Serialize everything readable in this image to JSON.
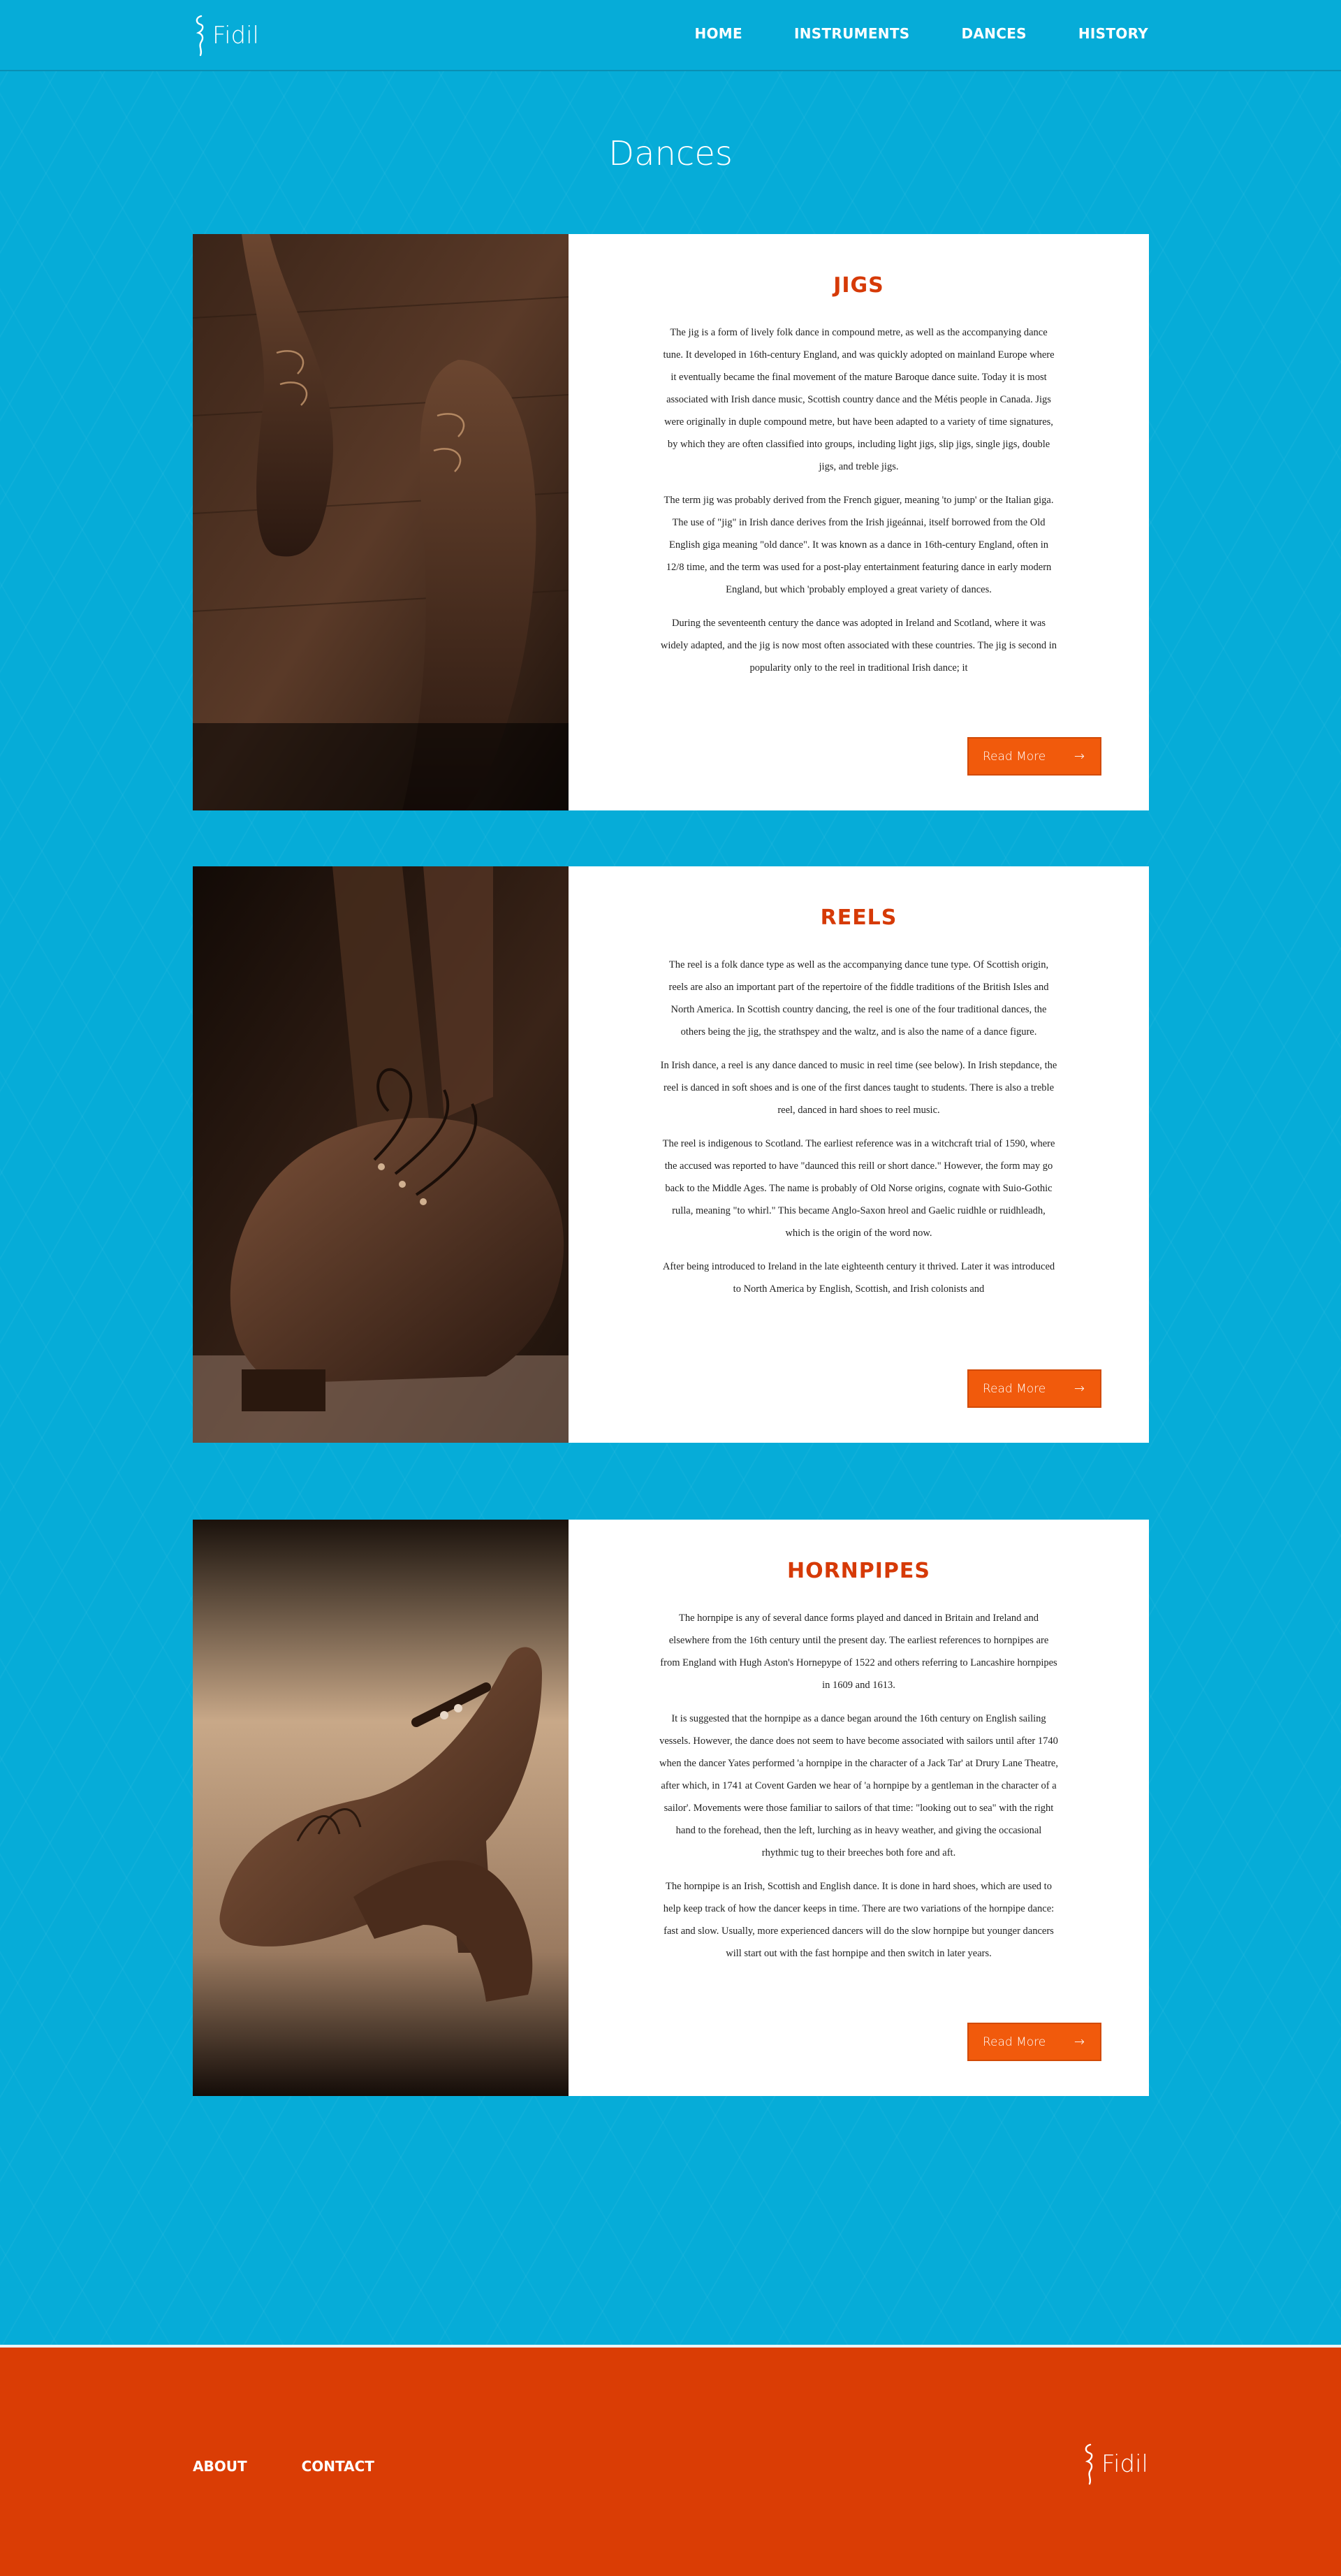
{
  "site": {
    "logo_text": "Fidil",
    "nav": [
      "HOME",
      "INSTRUMENTS",
      "DANCES",
      "HISTORY"
    ]
  },
  "page": {
    "title": "Dances"
  },
  "cards": [
    {
      "title": "JIGS",
      "photo_alt": "sepia photo of worn leather dance shoes on a wooden floor",
      "paragraphs": [
        "The jig is a form of lively folk dance in compound metre, as well as the accompanying dance tune. It developed in 16th-century England, and was quickly adopted on mainland Europe where it eventually became the final movement of the mature Baroque dance suite. Today it is most associated with Irish dance music, Scottish country dance and the Métis people in Canada. Jigs were originally in duple compound metre, but have been adapted to a variety of time signatures, by which they are often classified into groups, including light jigs, slip jigs, single jigs, double jigs, and treble jigs.",
        "The term jig was probably derived from the French giguer, meaning 'to jump' or the Italian giga. The use of \"jig\" in Irish dance derives from the Irish jigeánnai, itself borrowed from the Old English giga meaning \"old dance\". It was known as a dance in 16th-century England, often in 12/8 time, and the term was used for a post-play entertainment featuring dance in early modern England, but which 'probably employed a great variety of dances.",
        "During the seventeenth century the dance was adopted in Ireland and Scotland, where it was widely adapted, and the jig is now most often associated with these countries. The jig is second in popularity only to the reel in traditional Irish dance; it"
      ],
      "button": "Read More"
    },
    {
      "title": "REELS",
      "photo_alt": "sepia photo of a laced leather dance shoe",
      "paragraphs": [
        "The reel is a folk dance type as well as the accompanying dance tune type. Of Scottish origin, reels are also an important part of the repertoire of the fiddle traditions of the British Isles and North America. In Scottish country dancing, the reel is one of the four traditional dances, the others being the jig, the strathspey and the waltz, and is also the name of a dance figure.",
        "In Irish dance, a reel is any dance danced to music in reel time (see below). In Irish stepdance, the reel is danced in soft shoes and is one of the first dances taught to students. There is also a treble reel, danced in hard shoes to reel music.",
        "The reel is indigenous to Scotland. The earliest reference was in a witchcraft trial of 1590, where the accused was reported to have \"daunced this reill or short dance.\" However, the form may go back to the Middle Ages. The name is probably of Old Norse origins, cognate with Suio-Gothic rulla, meaning \"to whirl.\" This became Anglo-Saxon hreol and Gaelic ruidhle or ruidhleadh, which is the origin of the word now.",
        "After being introduced to Ireland in the late eighteenth century it thrived. Later it was introduced to North America by English, Scottish, and Irish colonists and"
      ],
      "button": "Read More"
    },
    {
      "title": "HORNPIPES",
      "photo_alt": "sepia photo of heeled leather hornpipe shoes with a buckle strap",
      "paragraphs": [
        "The hornpipe is any of several dance forms played and danced in Britain and Ireland and elsewhere from the 16th century until the present day. The earliest references to hornpipes are from England with Hugh Aston's Hornepype of 1522 and others referring to Lancashire hornpipes in 1609 and 1613.",
        "It is suggested that the hornpipe as a dance began around the 16th century on English sailing vessels. However, the dance does not seem to have become associated with sailors until after 1740 when the dancer Yates performed 'a hornpipe in the character of a Jack Tar' at Drury Lane Theatre, after which, in 1741 at Covent Garden we hear of 'a hornpipe by a gentleman in the character of a sailor'. Movements were those familiar to sailors of that time: \"looking out to sea\" with the right hand to the forehead, then the left, lurching as in heavy weather, and giving the occasional rhythmic tug to their breeches both fore and aft.",
        "The hornpipe is an Irish, Scottish and English dance. It is done in hard shoes, which are used to help keep track of how the dancer keeps in time. There are two variations of the hornpipe dance: fast and slow. Usually, more experienced dancers will do the slow hornpipe but younger dancers will start out with the fast hornpipe and then switch in later years."
      ],
      "button": "Read More"
    }
  ],
  "footer": {
    "links": [
      "ABOUT",
      "CONTACT"
    ],
    "logo_text": "Fidil"
  },
  "colors": {
    "background": "#06acd8",
    "accent": "#d63a07",
    "button": "#f15a0c",
    "footer": "#da3d05"
  },
  "icons": {
    "logo": "fiddle-scroll-icon",
    "button_arrow": "arrow-right-icon"
  }
}
